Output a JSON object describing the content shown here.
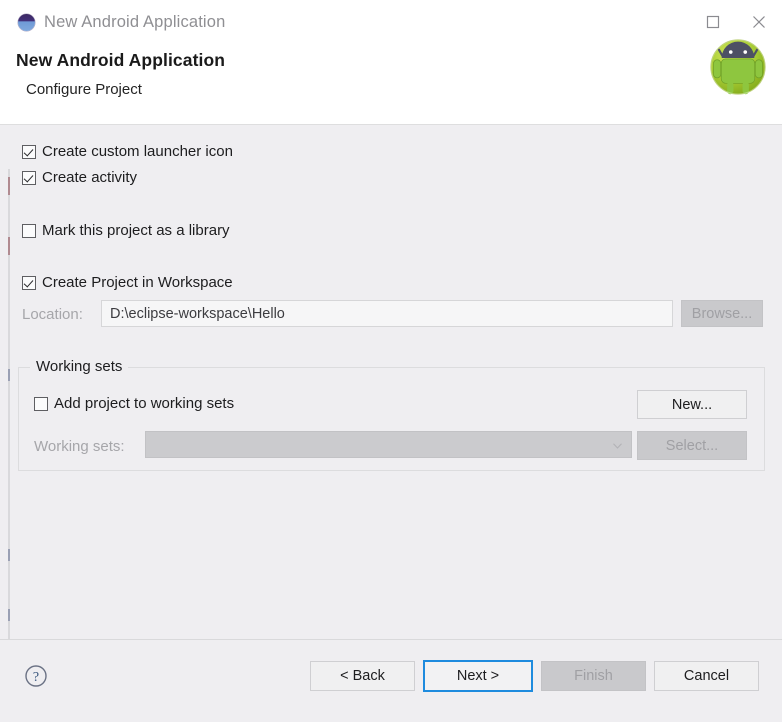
{
  "window": {
    "title": "New Android Application",
    "icon": "android-circle-icon",
    "controls": [
      {
        "name": "maximize-button",
        "glyph": "maximize-icon"
      },
      {
        "name": "close-button",
        "glyph": "close-icon"
      }
    ]
  },
  "header": {
    "title": "New Android Application",
    "subtitle": "Configure Project",
    "logo": "android-robot-icon"
  },
  "form": {
    "checkboxes": [
      {
        "label": "Create custom launcher icon",
        "checked": true,
        "enabled": true
      },
      {
        "label": "Create activity",
        "checked": true,
        "enabled": true
      },
      {
        "label": "Mark this project as a library",
        "checked": false,
        "enabled": true
      },
      {
        "label": "Create Project in Workspace",
        "checked": true,
        "enabled": true
      }
    ],
    "location": {
      "label": "Location:",
      "value": "D:\\eclipse-workspace\\Hello",
      "enabled": false,
      "browse_label": "Browse...",
      "browse_enabled": false
    }
  },
  "working_sets": {
    "legend": "Working sets",
    "add_checkbox": {
      "label": "Add project to working sets",
      "checked": false
    },
    "new_button": {
      "label": "New...",
      "enabled": true
    },
    "sets_label": "Working sets:",
    "sets_value": "",
    "select_button": {
      "label": "Select...",
      "enabled": false
    }
  },
  "footer": {
    "help": "help-icon",
    "buttons": [
      {
        "name": "back-button",
        "label": "< Back",
        "enabled": true,
        "focused": false
      },
      {
        "name": "next-button",
        "label": "Next >",
        "enabled": true,
        "focused": true
      },
      {
        "name": "finish-button",
        "label": "Finish",
        "enabled": false,
        "focused": false
      },
      {
        "name": "cancel-button",
        "label": "Cancel",
        "enabled": true,
        "focused": false
      }
    ]
  },
  "colors": {
    "body_background": "#efeef1",
    "header_background": "#ffffff",
    "focus_border": "#1e8bde",
    "android_green": "#a4ca39",
    "disabled_text": "#a0a0a4"
  }
}
